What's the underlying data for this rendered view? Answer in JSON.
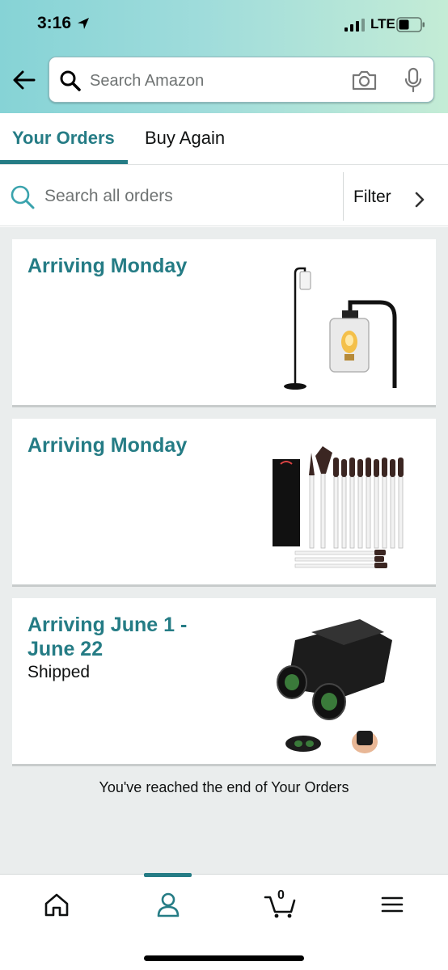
{
  "status_bar": {
    "time": "3:16",
    "network": "LTE"
  },
  "search": {
    "placeholder": "Search Amazon"
  },
  "tabs": [
    {
      "label": "Your Orders",
      "active": true
    },
    {
      "label": "Buy Again",
      "active": false
    }
  ],
  "orders_search": {
    "placeholder": "Search all orders",
    "filter_label": "Filter"
  },
  "orders": [
    {
      "title": "Arriving Monday",
      "status": "",
      "image": "floor-lamp"
    },
    {
      "title": "Arriving Monday",
      "status": "",
      "image": "makeup-brush-set"
    },
    {
      "title": "Arriving June 1 - June 22",
      "status": "Shipped",
      "image": "binoculars"
    }
  ],
  "end_message": "You've reached the end of Your Orders",
  "bottom_nav": {
    "items": [
      "home-icon",
      "account-icon",
      "cart-icon",
      "menu-icon"
    ],
    "active": "account-icon",
    "cart_count": "0"
  },
  "colors": {
    "accent": "#257c85",
    "header_gradient_start": "#86d3d6",
    "header_gradient_end": "#c4ecd6"
  }
}
